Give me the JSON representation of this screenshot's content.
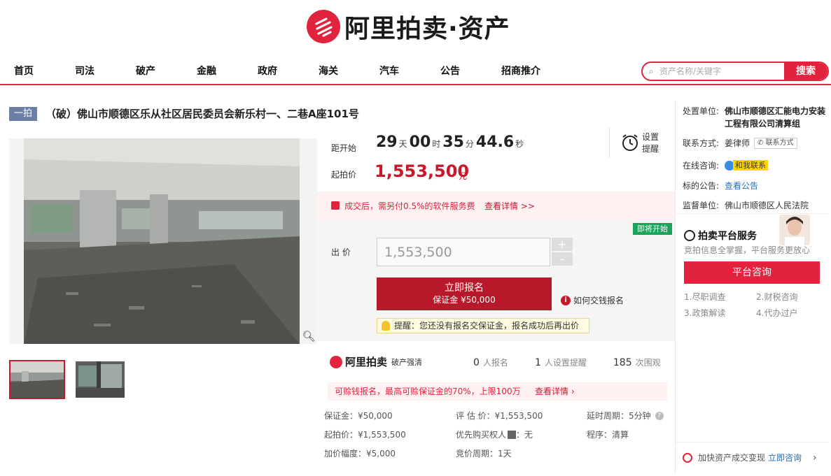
{
  "header": {
    "logo_text": "阿里拍卖·资产",
    "nav": [
      "首页",
      "司法",
      "破产",
      "金融",
      "政府",
      "海关",
      "汽车",
      "公告",
      "招商推介"
    ],
    "search": {
      "placeholder": "资产名称/关键字",
      "button": "搜索"
    }
  },
  "item": {
    "tag": "一拍",
    "title": "（破）佛山市顺德区乐从社区居民委员会新乐村一、二巷A座101号"
  },
  "countdown": {
    "label": "距开始",
    "days": "29",
    "days_unit": "天",
    "hours": "00",
    "hours_unit": "时",
    "minutes": "35",
    "minutes_unit": "分",
    "seconds": "44.6",
    "seconds_unit": "秒",
    "remind_label": "设置\n提醒"
  },
  "start_price": {
    "label": "起拍价",
    "value": "1,553,500",
    "unit": "元"
  },
  "fee_notice": {
    "text": "成交后，需另付0.5%的软件服务费",
    "link": "查看详情 >>"
  },
  "bid": {
    "soon_badge": "即将开始",
    "label": "出 价",
    "value": "1,553,500",
    "plus": "+",
    "minus": "-",
    "enroll_button": "立即报名",
    "enroll_sub": "保证金 ¥50,000",
    "how_to_pay": "如何交钱报名",
    "tip": "提醒：您还没有报名交保证金，报名成功后再出价"
  },
  "stats_bar": {
    "brand": "阿里拍卖",
    "brand_sub": "破产强清",
    "enrolled": "0",
    "enrolled_label": "人报名",
    "reminders": "1",
    "reminders_label": "人设置提醒",
    "views": "185",
    "views_label": "次围观"
  },
  "insurance": {
    "text": "可赊钱报名，最高可赊保证金的70%，上限100万",
    "link": "查看详情 ›"
  },
  "details": {
    "deposit": "保证金：¥50,000",
    "appraisal": "评 估 价：¥1,553,500",
    "delay": "延时周期：5分钟",
    "start": "起拍价：¥1,553,500",
    "priority": "优先购买权人",
    "priority_value": "：无",
    "procedure": "程序：清算",
    "increment": "加价幅度：¥5,000",
    "cycle": "竞价周期：1天"
  },
  "right_panel": {
    "org_label": "处置单位:",
    "org_value": "佛山市顺德区汇能电力安装工程有限公司清算组",
    "contact_label": "联系方式:",
    "contact_name": "姜律师",
    "contact_button": "联系方式",
    "online_label": "在线咨询:",
    "online_button": "和我联系",
    "notice_label": "标的公告:",
    "notice_link": "查看公告",
    "supervisor_label": "监督单位:",
    "supervisor_value": "佛山市顺德区人民法院",
    "service_title": "拍卖平台服务",
    "service_sub": "竞拍信息全掌握，平台服务更放心",
    "consult_button": "平台咨询",
    "services": [
      "1.尽职调查",
      "2.财税咨询",
      "3.政策解读",
      "4.代办过户"
    ],
    "fast_text": "加快资产成交变现",
    "fast_link": "立即咨询"
  },
  "colors": {
    "brand_red": "#e2233e",
    "button_red": "#b7192b",
    "soon_green": "#1aa35a"
  }
}
